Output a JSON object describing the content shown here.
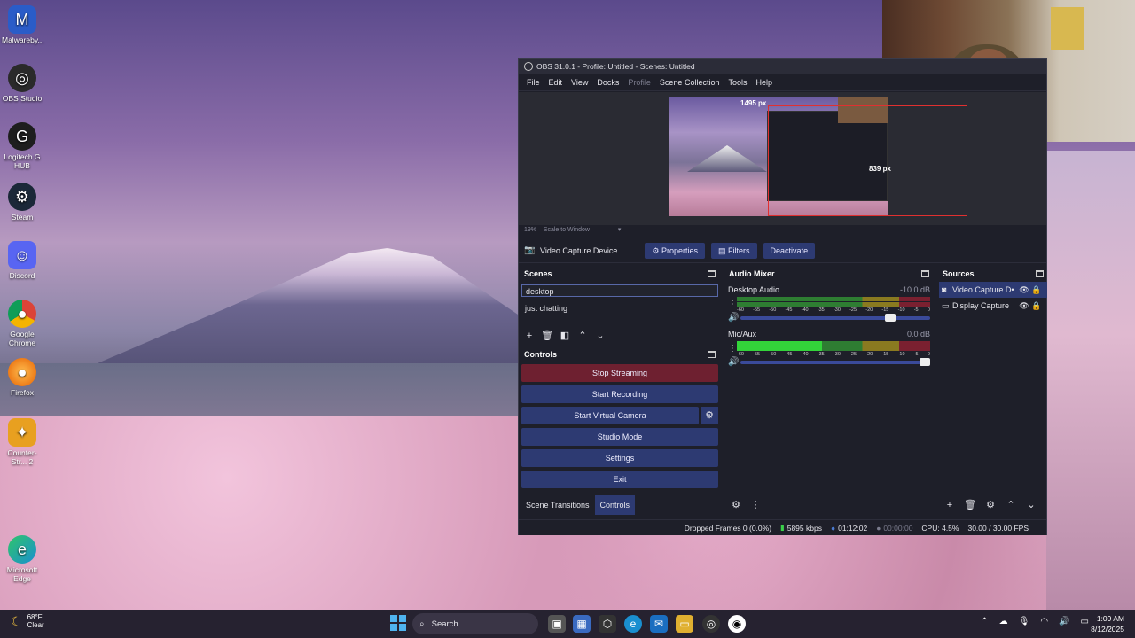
{
  "desktop_icons": [
    {
      "label": "Malwareby...",
      "icon": "malwarebytes-icon",
      "color": "#2a5cc8"
    },
    {
      "label": "OBS Studio",
      "icon": "obs-icon",
      "color": "#2a2a2a"
    },
    {
      "label": "Logitech G HUB",
      "icon": "logitech-icon",
      "color": "#1e1e1e"
    },
    {
      "label": "Steam",
      "icon": "steam-icon",
      "color": "#1b2838"
    },
    {
      "label": "Discord",
      "icon": "discord-icon",
      "color": "#5865f2"
    },
    {
      "label": "Google Chrome",
      "icon": "chrome-icon",
      "color": "#db4437"
    },
    {
      "label": "Firefox",
      "icon": "firefox-icon",
      "color": "#e66000"
    },
    {
      "label": "Counter-Str... 2",
      "icon": "cs2-icon",
      "color": "#e8a020"
    },
    {
      "label": "Microsoft Edge",
      "icon": "edge-icon",
      "color": "#1a8fd0"
    }
  ],
  "obs": {
    "title": "OBS 31.0.1 - Profile: Untitled - Scenes: Untitled",
    "menu": [
      "File",
      "Edit",
      "View",
      "Docks",
      "Profile",
      "Scene Collection",
      "Tools",
      "Help"
    ],
    "preview": {
      "width_label": "1495 px",
      "height_label": "839 px",
      "zoom": "19%",
      "scale_mode": "Scale to Window"
    },
    "source_bar": {
      "current_source": "Video Capture Device",
      "properties": "Properties",
      "filters": "Filters",
      "deactivate": "Deactivate"
    },
    "scenes": {
      "title": "Scenes",
      "items": [
        "desktop",
        "just chatting"
      ],
      "active": "desktop"
    },
    "controls": {
      "title": "Controls",
      "stop_streaming": "Stop Streaming",
      "start_recording": "Start Recording",
      "start_virtual_camera": "Start Virtual Camera",
      "studio_mode": "Studio Mode",
      "settings": "Settings",
      "exit": "Exit"
    },
    "dock_tabs": {
      "scene_transitions": "Scene Transitions",
      "controls": "Controls"
    },
    "mixer": {
      "title": "Audio Mixer",
      "channels": [
        {
          "name": "Desktop Audio",
          "db": "-10.0 dB",
          "volume": 0.82,
          "level": 0.0
        },
        {
          "name": "Mic/Aux",
          "db": "0.0 dB",
          "volume": 1.0,
          "level": 0.44
        }
      ],
      "ticks": [
        "-60",
        "-55",
        "-50",
        "-45",
        "-40",
        "-35",
        "-30",
        "-25",
        "-20",
        "-15",
        "-10",
        "-5",
        "0"
      ]
    },
    "sources": {
      "title": "Sources",
      "items": [
        {
          "name": "Video Capture D•",
          "icon": "camera-icon"
        },
        {
          "name": "Display Capture",
          "icon": "monitor-icon"
        }
      ]
    },
    "status": {
      "dropped": "Dropped Frames 0 (0.0%)",
      "bitrate": "5895 kbps",
      "stream_time": "01:12:02",
      "rec_time": "00:00:00",
      "cpu": "CPU: 4.5%",
      "fps": "30.00 / 30.00 FPS"
    }
  },
  "taskbar": {
    "weather_temp": "68°F",
    "weather_desc": "Clear",
    "search_placeholder": "Search",
    "time": "1:09 AM",
    "date": "8/12/2025"
  }
}
